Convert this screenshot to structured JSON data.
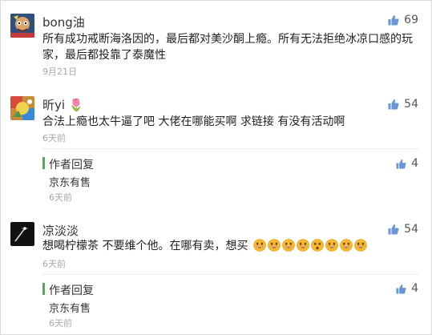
{
  "comments": [
    {
      "nickname": "bong油",
      "text": "所有成功戒断海洛因的，最后都对美沙酮上瘾。所有无法拒绝冰凉口感的玩家，最后都投靠了泰魔性",
      "time": "9月21日",
      "likes": "69",
      "avatar_icon": "painting-avatar"
    },
    {
      "nickname": "昕yi 🌷",
      "text": "合法上瘾也太牛逼了吧 大佬在哪能买啊  求链接  有没有活动啊",
      "time": "6天前",
      "likes": "54",
      "avatar_icon": "colorful-avatar",
      "reply": {
        "title": "作者回复",
        "text": "京东有售",
        "time": "6天前",
        "likes": "4"
      }
    },
    {
      "nickname": "凉淡淡",
      "text": "想喝柠檬茶 不要维个他。在哪有卖，想买",
      "time": "6天前",
      "likes": "54",
      "avatar_icon": "dark-avatar",
      "emojis": [
        "grin-emoji",
        "grin-emoji",
        "grin-emoji",
        "grin-emoji",
        "dizzy-emoji",
        "grin-emoji",
        "grin-emoji",
        "grin-emoji"
      ],
      "reply": {
        "title": "作者回复",
        "text": "京东有售",
        "time": "6天前",
        "likes": "4"
      }
    }
  ],
  "colors": {
    "like_icon": "#6a96d6",
    "reply_bar": "#44b549",
    "time": "#a8a8a8",
    "divider": "#e8e8e8"
  }
}
